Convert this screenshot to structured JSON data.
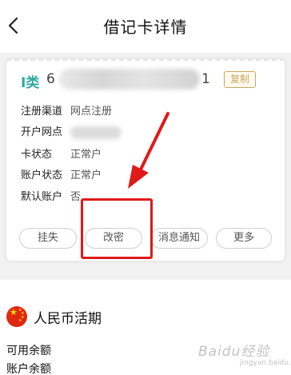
{
  "header": {
    "title": "借记卡详情",
    "back_icon": "chevron-left-icon"
  },
  "card": {
    "number_prefix": "I类",
    "number_first_digit": "6",
    "number_last_digit": "1",
    "copy_label": "复制",
    "rows": [
      {
        "label": "注册渠道",
        "value": "网点注册"
      },
      {
        "label": "开户网点",
        "value": ""
      },
      {
        "label": "卡状态",
        "value": "正常户"
      },
      {
        "label": "账户状态",
        "value": "正常户"
      },
      {
        "label": "默认账户",
        "value": "否"
      }
    ],
    "actions": {
      "report_loss": "挂失",
      "change_password": "改密",
      "notifications": "消息通知",
      "more": "更多"
    }
  },
  "account": {
    "title": "人民币活期",
    "flag_icon": "china-flag-icon",
    "available_balance_label": "可用余额",
    "account_balance_label": "账户余额"
  },
  "annotation_color": "#e01919",
  "watermark": {
    "main": "Baidu经验",
    "sub": "jingyan.baidu.com"
  }
}
